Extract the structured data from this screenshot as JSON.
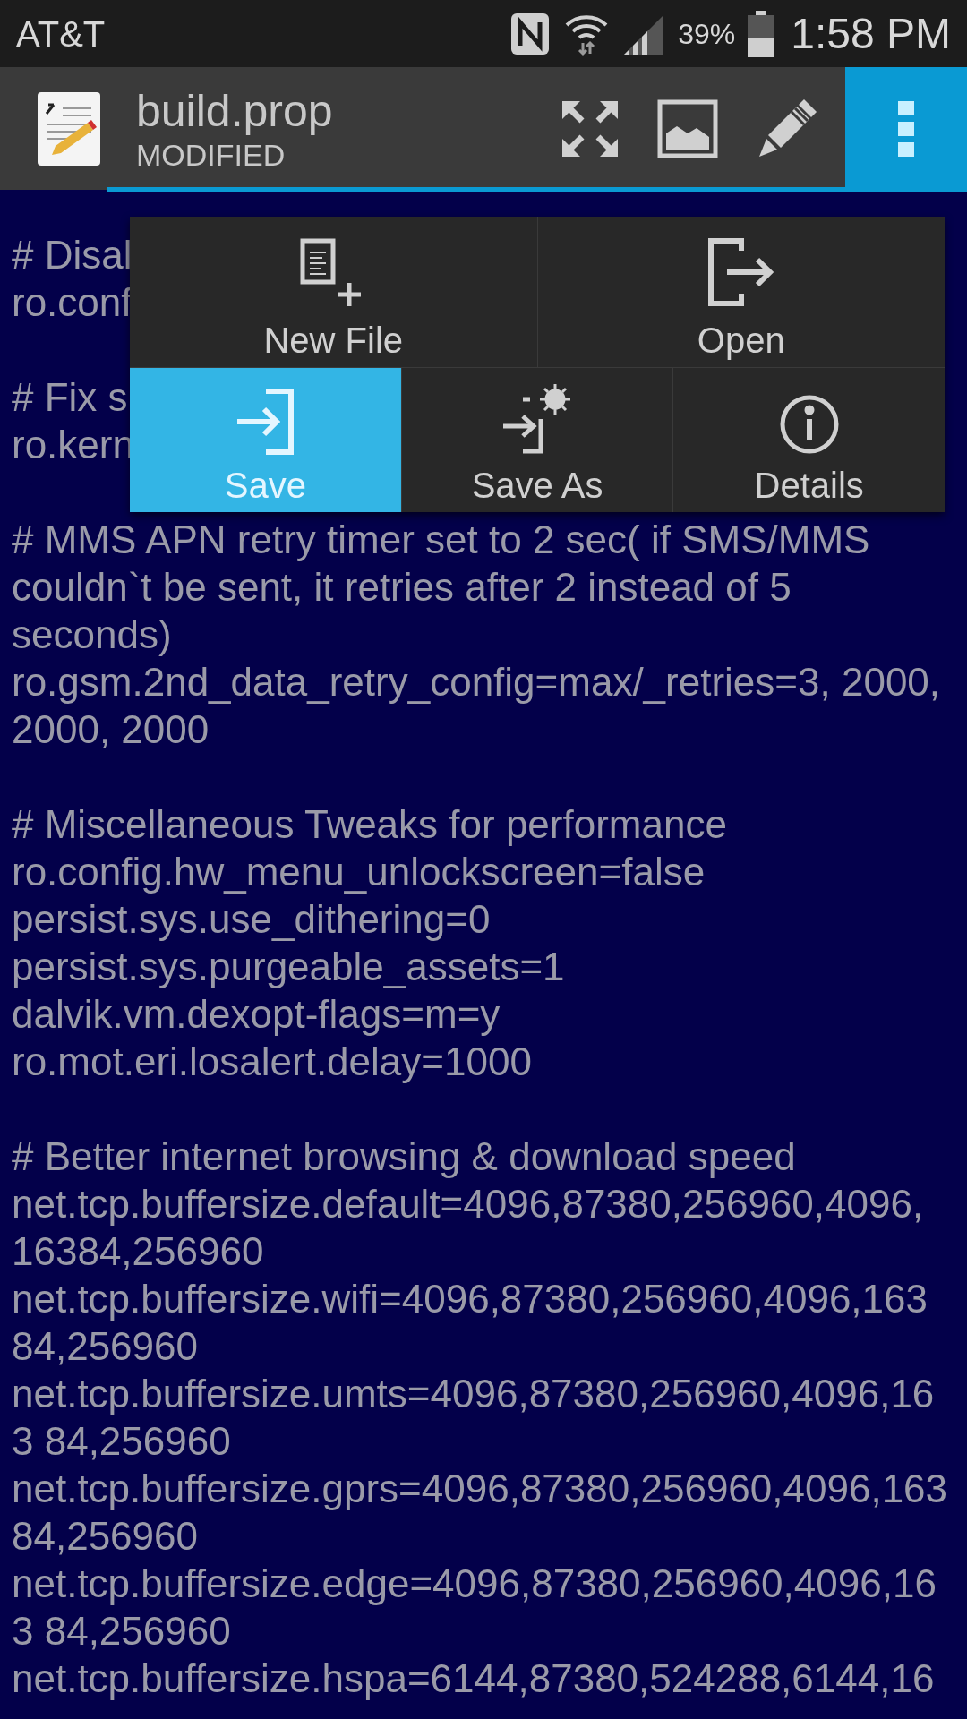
{
  "status_bar": {
    "carrier": "AT&T",
    "battery": "39%",
    "time": "1:58 PM"
  },
  "app_bar": {
    "title": "build.prop",
    "subtitle": "MODIFIED"
  },
  "editor": {
    "blocks": [
      {
        "lines": [
          "# Disal",
          "ro.conf"
        ]
      },
      {
        "lines": [
          "# Fix s",
          "ro.kern"
        ]
      },
      {
        "lines": [
          "# MMS APN retry timer set to 2 sec( if SMS/MMS",
          "couldn`t be sent, it retries after 2 instead of 5",
          "seconds)",
          "ro.gsm.2nd_data_retry_config=max/_retries=3, 2000,",
          "2000, 2000"
        ]
      },
      {
        "lines": [
          "# Miscellaneous Tweaks for performance",
          "ro.config.hw_menu_unlockscreen=false",
          "persist.sys.use_dithering=0",
          "persist.sys.purgeable_assets=1",
          "dalvik.vm.dexopt-flags=m=y",
          "ro.mot.eri.losalert.delay=1000"
        ]
      },
      {
        "lines": [
          "# Better internet browsing & download speed",
          "net.tcp.buffersize.default=4096,87380,256960,4096,",
          "16384,256960",
          "net.tcp.buffersize.wifi=4096,87380,256960,4096,163",
          "84,256960",
          "net.tcp.buffersize.umts=4096,87380,256960,4096,16",
          "3 84,256960",
          "net.tcp.buffersize.gprs=4096,87380,256960,4096,163",
          "84,256960",
          "net.tcp.buffersize.edge=4096,87380,256960,4096,16",
          "3 84,256960",
          "net.tcp.buffersize.hspa=6144,87380,524288,6144,16"
        ]
      }
    ]
  },
  "menu": {
    "rows": [
      [
        {
          "kind": "new-file",
          "label": "New File",
          "selected": false
        },
        {
          "kind": "open",
          "label": "Open",
          "selected": false
        }
      ],
      [
        {
          "kind": "save",
          "label": "Save",
          "selected": true
        },
        {
          "kind": "save-as",
          "label": "Save As",
          "selected": false
        },
        {
          "kind": "details",
          "label": "Details",
          "selected": false
        }
      ]
    ]
  }
}
